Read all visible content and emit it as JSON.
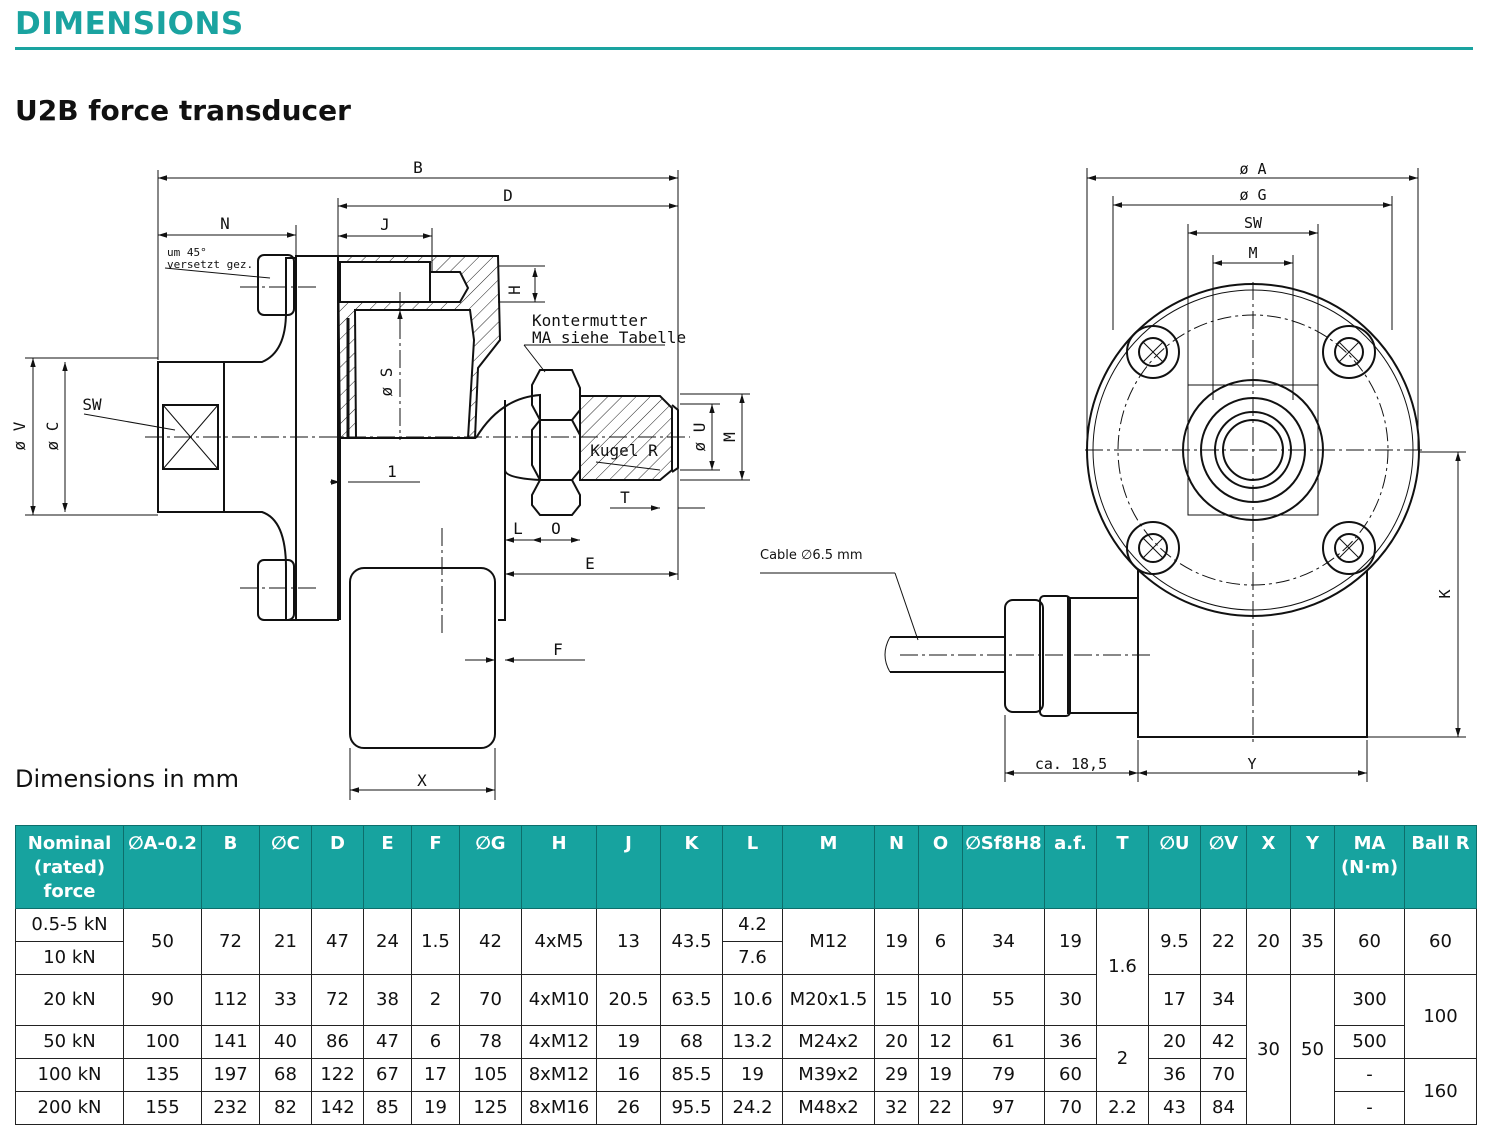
{
  "header": {
    "section": "DIMENSIONS",
    "title": "U2B force transducer",
    "units_note": "Dimensions in mm"
  },
  "drawing": {
    "labels": {
      "B": "B",
      "D": "D",
      "N": "N",
      "J": "J",
      "H": "H",
      "S": "ø S",
      "V": "ø V",
      "C": "ø C",
      "SW": "SW",
      "one": "1",
      "U": "ø U",
      "M": "M",
      "T": "T",
      "L": "L",
      "O": "O",
      "E": "E",
      "F": "F",
      "X": "X",
      "kugel": "Kugel R",
      "note1": "um 45°",
      "note2": "versetzt gez.",
      "konter1": "Kontermutter",
      "konter2": "MA siehe Tabelle",
      "A2": "ø A",
      "G2": "ø G",
      "SW2": "SW",
      "M2": "M",
      "K": "K",
      "Y": "Y",
      "ca": "ca. 18,5",
      "cable": "Cable ∅6.5 mm"
    }
  },
  "table": {
    "headers": [
      "Nominal (rated) force",
      "∅A-0.2",
      "B",
      "∅C",
      "D",
      "E",
      "F",
      "∅G",
      "H",
      "J",
      "K",
      "L",
      "M",
      "N",
      "O",
      "∅Sf8H8",
      "a.f.",
      "T",
      "∅U",
      "∅V",
      "X",
      "Y",
      "MA (N·m)",
      "Ball R"
    ],
    "rows": {
      "r1": {
        "force": "0.5-5 kN",
        "A": "50",
        "B": "72",
        "C": "21",
        "D": "47",
        "E": "24",
        "F": "1.5",
        "G": "42",
        "H": "4xM5",
        "J": "13",
        "K": "43.5",
        "L": "4.2",
        "M": "M12",
        "N": "19",
        "O": "6",
        "S": "34",
        "af": "19",
        "T": "1.6",
        "U": "9.5",
        "V": "22",
        "X": "20",
        "Y": "35",
        "MA": "60",
        "R": "60"
      },
      "r2": {
        "force": "10 kN",
        "L": "7.6"
      },
      "r3": {
        "force": "20 kN",
        "A": "90",
        "B": "112",
        "C": "33",
        "D": "72",
        "E": "38",
        "F": "2",
        "G": "70",
        "H": "4xM10",
        "J": "20.5",
        "K": "63.5",
        "L": "10.6",
        "M": "M20x1.5",
        "N": "15",
        "O": "10",
        "S": "55",
        "af": "30",
        "U": "17",
        "V": "34",
        "X": "30",
        "Y": "50",
        "MA": "300",
        "R": "100"
      },
      "r4": {
        "force": "50 kN",
        "A": "100",
        "B": "141",
        "C": "40",
        "D": "86",
        "E": "47",
        "F": "6",
        "G": "78",
        "H": "4xM12",
        "J": "19",
        "K": "68",
        "L": "13.2",
        "M": "M24x2",
        "N": "20",
        "O": "12",
        "S": "61",
        "af": "36",
        "T": "2",
        "U": "20",
        "V": "42",
        "MA": "500"
      },
      "r5": {
        "force": "100 kN",
        "A": "135",
        "B": "197",
        "C": "68",
        "D": "122",
        "E": "67",
        "F": "17",
        "G": "105",
        "H": "8xM12",
        "J": "16",
        "K": "85.5",
        "L": "19",
        "M": "M39x2",
        "N": "29",
        "O": "19",
        "S": "79",
        "af": "60",
        "U": "36",
        "V": "70",
        "MA": "-",
        "R": "160"
      },
      "r6": {
        "force": "200 kN",
        "A": "155",
        "B": "232",
        "C": "82",
        "D": "142",
        "E": "85",
        "F": "19",
        "G": "125",
        "H": "8xM16",
        "J": "26",
        "K": "95.5",
        "L": "24.2",
        "M": "M48x2",
        "N": "32",
        "O": "22",
        "S": "97",
        "af": "70",
        "T": "2.2",
        "U": "43",
        "V": "84",
        "MA": "-"
      }
    }
  }
}
